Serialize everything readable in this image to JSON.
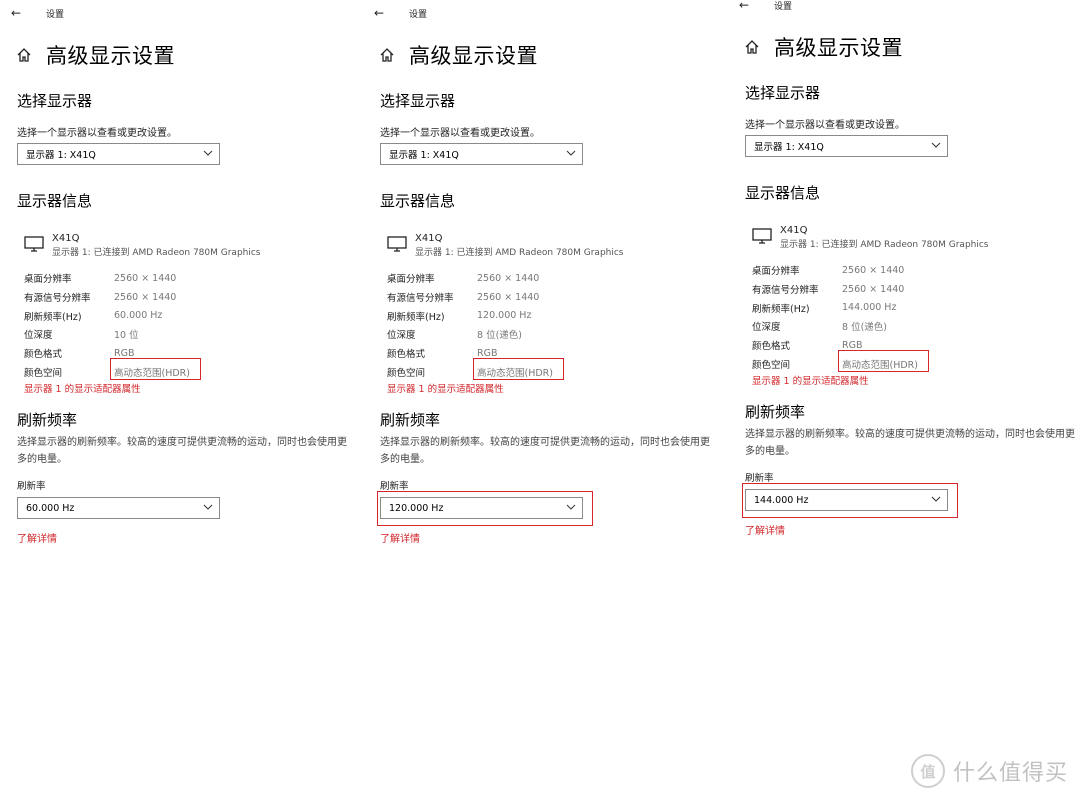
{
  "panels": [
    {
      "window_title": "设置",
      "page_title": "高级显示设置",
      "select_display_heading": "选择显示器",
      "select_display_hint": "选择一个显示器以查看或更改设置。",
      "display_select_value": "显示器 1: X41Q",
      "display_info_heading": "显示器信息",
      "monitor_name": "X41Q",
      "monitor_sub": "显示器 1: 已连接到 AMD Radeon 780M Graphics",
      "info": [
        {
          "label": "桌面分辨率",
          "value": "2560 × 1440"
        },
        {
          "label": "有源信号分辨率",
          "value": "2560 × 1440"
        },
        {
          "label": "刷新频率(Hz)",
          "value": "60.000 Hz"
        },
        {
          "label": "位深度",
          "value": "10 位"
        },
        {
          "label": "颜色格式",
          "value": "RGB"
        },
        {
          "label": "颜色空间",
          "value": "高动态范围(HDR)"
        }
      ],
      "adapter_link": "显示器 1 的显示适配器属性",
      "refresh_heading": "刷新频率",
      "refresh_desc": "选择显示器的刷新频率。较高的速度可提供更流畅的运动，同时也会使用更多的电量。",
      "refresh_rate_label": "刷新率",
      "refresh_rate_value": "60.000 Hz",
      "learn_more": "了解详情"
    },
    {
      "window_title": "设置",
      "page_title": "高级显示设置",
      "select_display_heading": "选择显示器",
      "select_display_hint": "选择一个显示器以查看或更改设置。",
      "display_select_value": "显示器 1: X41Q",
      "display_info_heading": "显示器信息",
      "monitor_name": "X41Q",
      "monitor_sub": "显示器 1: 已连接到 AMD Radeon 780M Graphics",
      "info": [
        {
          "label": "桌面分辨率",
          "value": "2560 × 1440"
        },
        {
          "label": "有源信号分辨率",
          "value": "2560 × 1440"
        },
        {
          "label": "刷新频率(Hz)",
          "value": "120.000 Hz"
        },
        {
          "label": "位深度",
          "value": "8 位(递色)"
        },
        {
          "label": "颜色格式",
          "value": "RGB"
        },
        {
          "label": "颜色空间",
          "value": "高动态范围(HDR)"
        }
      ],
      "adapter_link": "显示器 1 的显示适配器属性",
      "refresh_heading": "刷新频率",
      "refresh_desc": "选择显示器的刷新频率。较高的速度可提供更流畅的运动，同时也会使用更多的电量。",
      "refresh_rate_label": "刷新率",
      "refresh_rate_value": "120.000 Hz",
      "learn_more": "了解详情"
    },
    {
      "window_title": "设置",
      "page_title": "高级显示设置",
      "select_display_heading": "选择显示器",
      "select_display_hint": "选择一个显示器以查看或更改设置。",
      "display_select_value": "显示器 1: X41Q",
      "display_info_heading": "显示器信息",
      "monitor_name": "X41Q",
      "monitor_sub": "显示器 1: 已连接到 AMD Radeon 780M Graphics",
      "info": [
        {
          "label": "桌面分辨率",
          "value": "2560 × 1440"
        },
        {
          "label": "有源信号分辨率",
          "value": "2560 × 1440"
        },
        {
          "label": "刷新频率(Hz)",
          "value": "144.000 Hz"
        },
        {
          "label": "位深度",
          "value": "8 位(递色)"
        },
        {
          "label": "颜色格式",
          "value": "RGB"
        },
        {
          "label": "颜色空间",
          "value": "高动态范围(HDR)"
        }
      ],
      "adapter_link": "显示器 1 的显示适配器属性",
      "refresh_heading": "刷新频率",
      "refresh_desc": "选择显示器的刷新频率。较高的速度可提供更流畅的运动，同时也会使用更多的电量。",
      "refresh_rate_label": "刷新率",
      "refresh_rate_value": "144.000 Hz",
      "learn_more": "了解详情"
    }
  ],
  "highlight_color": "#d6262a",
  "link_color": "#d1252a",
  "watermark": {
    "text": "什么值得买",
    "icon": "值"
  }
}
